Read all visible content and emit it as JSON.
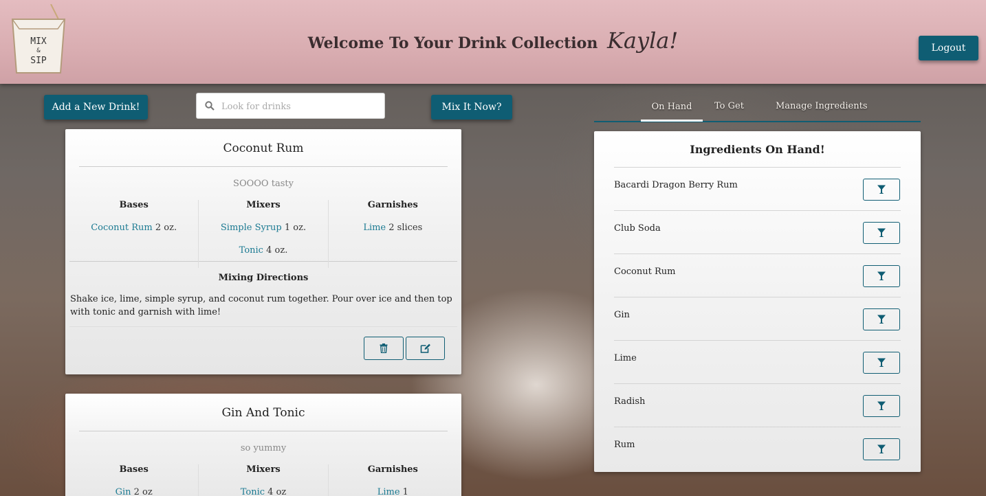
{
  "header": {
    "welcome": "Welcome To Your Drink Collection",
    "user_name": "Kayla!",
    "logout_label": "Logout",
    "logo_line1": "MIX",
    "logo_amp": "&",
    "logo_line2": "SIP"
  },
  "toolbar": {
    "add_drink_label": "Add a New Drink!",
    "search_placeholder": "Look for drinks",
    "mix_now_label": "Mix It Now?"
  },
  "drinks": [
    {
      "name": "Coconut Rum",
      "description": "SOOOO tasty",
      "bases_header": "Bases",
      "mixers_header": "Mixers",
      "garnishes_header": "Garnishes",
      "bases": [
        {
          "name": "Coconut Rum",
          "amount": "2 oz."
        }
      ],
      "mixers": [
        {
          "name": "Simple Syrup",
          "amount": "1 oz."
        },
        {
          "name": "Tonic",
          "amount": "4 oz."
        }
      ],
      "garnishes": [
        {
          "name": "Lime",
          "amount": "2 slices"
        }
      ],
      "directions_header": "Mixing Directions",
      "directions": "Shake ice, lime, simple syrup, and coconut rum together. Pour over ice and then top with tonic and garnish with lime!"
    },
    {
      "name": "Gin And Tonic",
      "description": "so yummy",
      "bases_header": "Bases",
      "mixers_header": "Mixers",
      "garnishes_header": "Garnishes",
      "bases": [
        {
          "name": "Gin",
          "amount": "2 oz"
        }
      ],
      "mixers": [
        {
          "name": "Tonic",
          "amount": "4 oz"
        }
      ],
      "garnishes": [
        {
          "name": "Lime",
          "amount": "1"
        }
      ]
    }
  ],
  "tabs": [
    {
      "label": "On Hand",
      "active": true
    },
    {
      "label": "To Get",
      "active": false
    },
    {
      "label": "Manage Ingredients",
      "active": false
    }
  ],
  "on_hand": {
    "title": "Ingredients On Hand!",
    "items": [
      "Bacardi Dragon Berry Rum",
      "Club Soda",
      "Coconut Rum",
      "Gin",
      "Lime",
      "Radish",
      "Rum"
    ]
  },
  "icons": {
    "search": "search-icon",
    "trash": "trash-icon",
    "edit": "edit-icon",
    "cocktail": "cocktail-glass-icon"
  },
  "colors": {
    "accent": "#0f5d73",
    "link": "#1b7a92",
    "header_bg": "#d9adb1"
  }
}
